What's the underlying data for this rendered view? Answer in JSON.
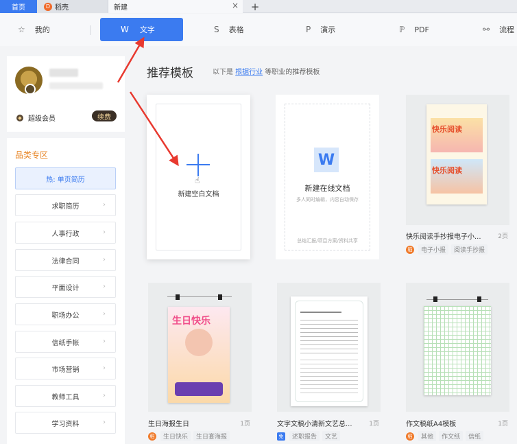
{
  "tabs": {
    "home": "首页",
    "daoke": "稻壳",
    "daoke_logo": "D",
    "new": "新建",
    "close": "×",
    "add": "+"
  },
  "categories": {
    "mine": "我的",
    "text": "文字",
    "sheet": "表格",
    "ppt": "演示",
    "pdf": "PDF",
    "flow": "流程"
  },
  "profile": {
    "member_label": "超级会员",
    "renew_label": "续费"
  },
  "category_panel": {
    "title": "品类专区",
    "items": [
      "热: 单页简历",
      "求职简历",
      "人事行政",
      "法律合同",
      "平面设计",
      "职场办公",
      "信纸手帐",
      "市场营销",
      "教师工具",
      "学习资料"
    ]
  },
  "main": {
    "title": "推荐模板",
    "subtitle_prefix": "以下是",
    "subtitle_link": "根据行业",
    "subtitle_suffix": "等职业的推荐模板"
  },
  "new_blank": {
    "label": "新建空白文档"
  },
  "new_online": {
    "logo": "W",
    "label": "新建在线文档",
    "desc": "多人同时编辑，内容自动保存",
    "footer": "总结汇报/项目方案/资料共享"
  },
  "templates": [
    {
      "name": "快乐阅读手抄报电子小...",
      "pages": "2页",
      "badge": "稻",
      "tags": [
        "电子小报",
        "阅读手抄报"
      ],
      "poster_title": "快乐阅读"
    },
    {
      "name": "生日海报生日",
      "pages": "1页",
      "badge": "稻",
      "tags": [
        "生日快乐",
        "生日宴海报"
      ],
      "poster_title": "生日快乐"
    },
    {
      "name": "文字文稿小清新文艺总...",
      "pages": "1页",
      "badge": "免",
      "tags": [
        "述职报告",
        "文艺"
      ]
    },
    {
      "name": "作文稿纸A4模板",
      "pages": "1页",
      "badge": "稻",
      "tags": [
        "其他",
        "作文纸",
        "信纸"
      ]
    }
  ],
  "colors": {
    "accent": "#3b7bf0",
    "arrow": "#e8392f",
    "member_gold": "#f3d69c"
  },
  "icons": {
    "mine": "star-icon",
    "text": "w-doc-icon",
    "sheet": "s-sheet-icon",
    "ppt": "p-ppt-icon",
    "pdf": "pdf-icon",
    "flow": "flowchart-icon"
  }
}
